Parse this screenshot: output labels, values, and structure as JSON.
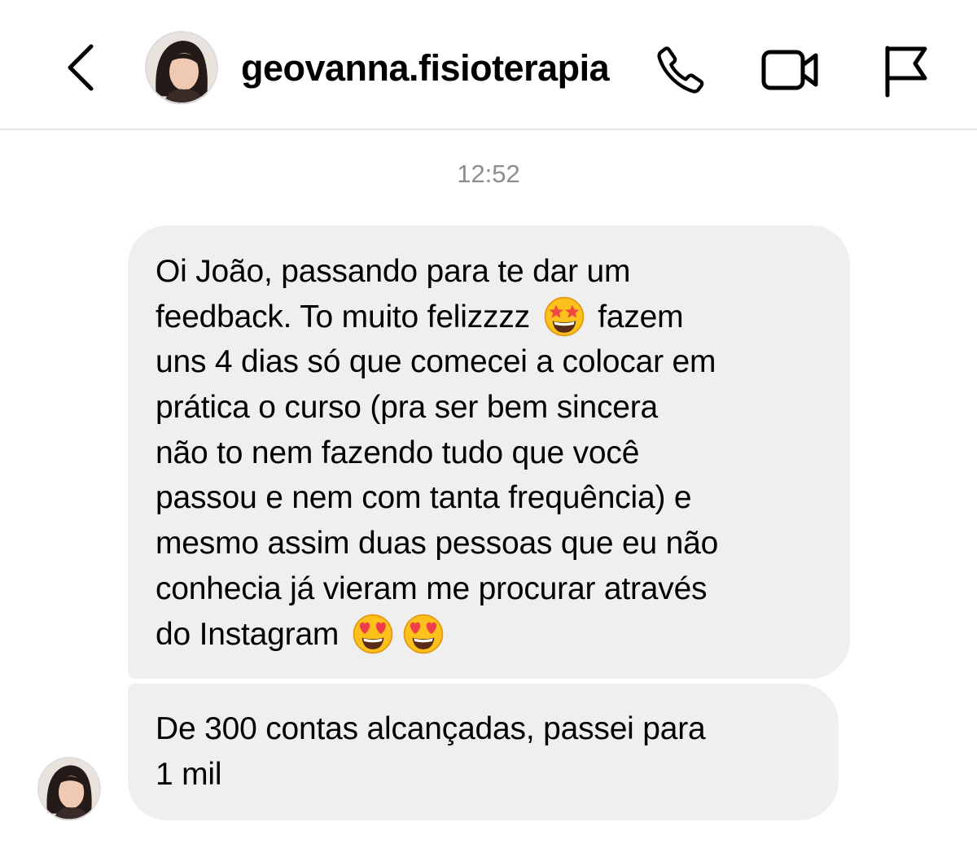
{
  "header": {
    "username": "geovanna.fisioterapia",
    "icons": {
      "back": "chevron-left-icon",
      "call": "phone-icon",
      "video": "video-camera-icon",
      "report": "flag-icon"
    }
  },
  "thread": {
    "timestamp": "12:52",
    "messages": [
      {
        "lines": [
          "Oi João, passando para te dar um",
          "feedback. To muito felizzzz",
          "fazem",
          "uns 4 dias só que comecei a colocar em",
          "prática o curso (pra ser bem sincera",
          "não to nem fazendo tudo que você",
          "passou e nem com tanta frequência) e",
          "mesmo assim duas pessoas que eu não",
          "conhecia já vieram me procurar através",
          "do Instagram"
        ],
        "emojis": [
          "star-struck-emoji",
          "heart-eyes-emoji",
          "heart-eyes-emoji"
        ]
      },
      {
        "lines": [
          "De 300 contas alcançadas, passei para",
          "1 mil"
        ]
      }
    ]
  },
  "colors": {
    "bubble": "#efefef",
    "timestamp": "#8e8e8e",
    "divider": "#e6e6e6"
  }
}
